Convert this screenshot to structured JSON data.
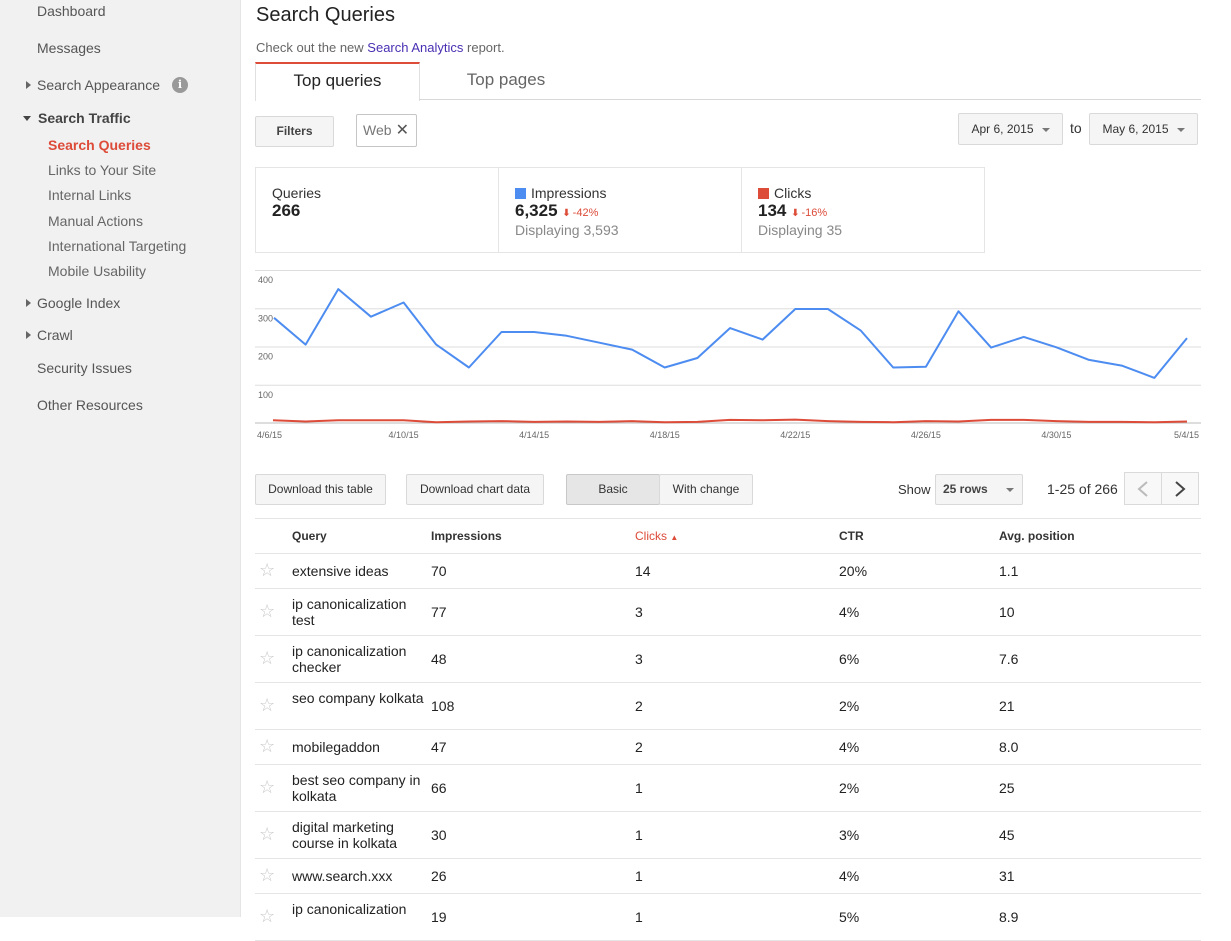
{
  "sidebar": {
    "dashboard": "Dashboard",
    "messages": "Messages",
    "search_appearance": "Search Appearance",
    "search_traffic": "Search Traffic",
    "sub_items": [
      "Search Queries",
      "Links to Your Site",
      "Internal Links",
      "Manual Actions",
      "International Targeting",
      "Mobile Usability"
    ],
    "google_index": "Google Index",
    "crawl": "Crawl",
    "security_issues": "Security Issues",
    "other_resources": "Other Resources"
  },
  "header": {
    "title": "Search Queries",
    "notice_prefix": "Check out the new ",
    "notice_link": "Search Analytics",
    "notice_suffix": " report."
  },
  "tabs": [
    "Top queries",
    "Top pages"
  ],
  "filters": {
    "filters_label": "Filters",
    "web_chip": "Web",
    "date_from": "Apr 6, 2015",
    "to_label": "to",
    "date_to": "May 6, 2015"
  },
  "summary": {
    "queries_label": "Queries",
    "queries_value": "266",
    "impressions_label": "Impressions",
    "impressions_value": "6,325",
    "impressions_change": "-42%",
    "impressions_displaying": "Displaying 3,593",
    "clicks_label": "Clicks",
    "clicks_value": "134",
    "clicks_change": "-16%",
    "clicks_displaying": "Displaying 35"
  },
  "colors": {
    "impressions": "#4d8cf0",
    "clicks": "#dd4b39",
    "accent": "#dd4b39",
    "link": "#4a2fb3"
  },
  "chart_data": {
    "type": "line",
    "x": [
      "4/6/15",
      "4/7/15",
      "4/8/15",
      "4/9/15",
      "4/10/15",
      "4/11/15",
      "4/12/15",
      "4/13/15",
      "4/14/15",
      "4/15/15",
      "4/16/15",
      "4/17/15",
      "4/18/15",
      "4/19/15",
      "4/20/15",
      "4/21/15",
      "4/22/15",
      "4/23/15",
      "4/24/15",
      "4/25/15",
      "4/26/15",
      "4/27/15",
      "4/28/15",
      "4/29/15",
      "4/30/15",
      "5/1/15",
      "5/2/15",
      "5/3/15",
      "5/4/15"
    ],
    "x_tick_labels": [
      "4/6/15",
      "4/10/15",
      "4/14/15",
      "4/18/15",
      "4/22/15",
      "4/26/15",
      "4/30/15",
      "5/4/15"
    ],
    "y_ticks": [
      100,
      200,
      300,
      400
    ],
    "ylim": [
      0,
      400
    ],
    "grid": true,
    "series": [
      {
        "name": "Impressions",
        "values": [
          275,
          205,
          350,
          278,
          315,
          205,
          145,
          238,
          238,
          228,
          210,
          192,
          145,
          170,
          248,
          218,
          298,
          298,
          242,
          145,
          147,
          292,
          197,
          225,
          198,
          165,
          150,
          118,
          222
        ]
      },
      {
        "name": "Clicks",
        "values": [
          7,
          4,
          7,
          7,
          7,
          2,
          4,
          5,
          3,
          4,
          3,
          5,
          2,
          3,
          8,
          7,
          9,
          5,
          3,
          2,
          5,
          4,
          8,
          8,
          5,
          3,
          3,
          2,
          4
        ]
      }
    ]
  },
  "table_controls": {
    "download_table": "Download this table",
    "download_chart": "Download chart data",
    "basic": "Basic",
    "with_change": "With change",
    "show_label": "Show",
    "rows_value": "25 rows",
    "range": "1-25 of 266"
  },
  "table": {
    "headers": [
      "Query",
      "Impressions",
      "Clicks",
      "CTR",
      "Avg. position"
    ],
    "rows": [
      {
        "query": "extensive ideas",
        "impressions": "70",
        "clicks": "14",
        "ctr": "20%",
        "position": "1.1"
      },
      {
        "query": "ip canonicalization test",
        "impressions": "77",
        "clicks": "3",
        "ctr": "4%",
        "position": "10"
      },
      {
        "query": "ip canonicalization checker",
        "impressions": "48",
        "clicks": "3",
        "ctr": "6%",
        "position": "7.6"
      },
      {
        "query": "seo company kolkata",
        "impressions": "108",
        "clicks": "2",
        "ctr": "2%",
        "position": "21"
      },
      {
        "query": "mobilegaddon",
        "impressions": "47",
        "clicks": "2",
        "ctr": "4%",
        "position": "8.0"
      },
      {
        "query": "best seo company in kolkata",
        "impressions": "66",
        "clicks": "1",
        "ctr": "2%",
        "position": "25"
      },
      {
        "query": "digital marketing course in kolkata",
        "impressions": "30",
        "clicks": "1",
        "ctr": "3%",
        "position": "45"
      },
      {
        "query": "www.search.xxx",
        "impressions": "26",
        "clicks": "1",
        "ctr": "4%",
        "position": "31"
      },
      {
        "query": "ip canonicalization",
        "impressions": "19",
        "clicks": "1",
        "ctr": "5%",
        "position": "8.9"
      }
    ]
  }
}
